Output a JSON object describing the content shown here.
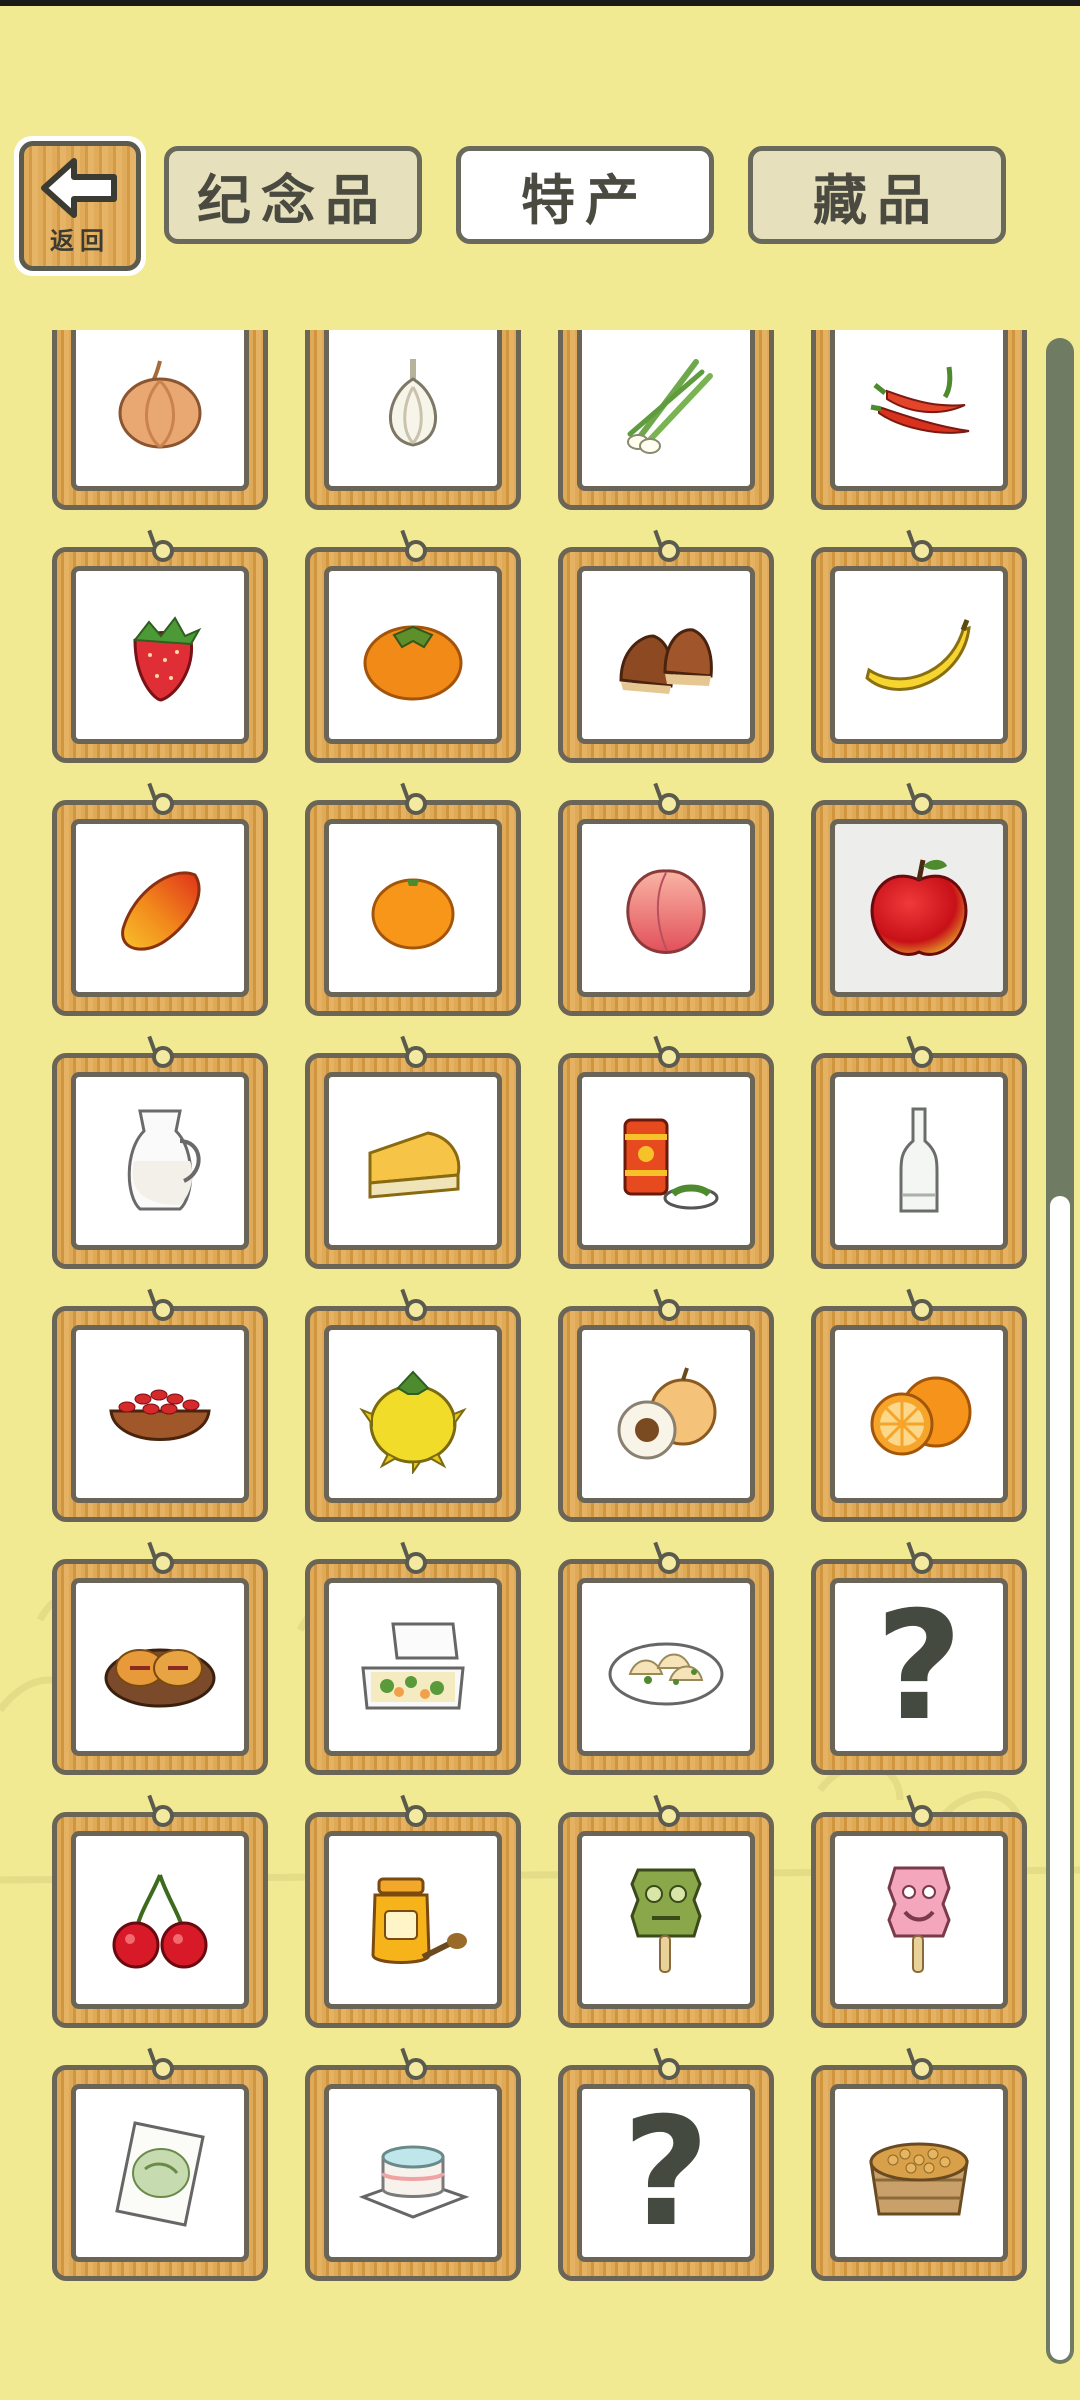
{
  "header": {
    "back_label": "返回",
    "tabs": [
      {
        "label": "纪念品",
        "active": false
      },
      {
        "label": "特产",
        "active": true
      },
      {
        "label": "藏品",
        "active": false
      }
    ]
  },
  "items": [
    {
      "icon": "onion-icon"
    },
    {
      "icon": "garlic-icon"
    },
    {
      "icon": "green-onion-icon"
    },
    {
      "icon": "chili-pepper-icon"
    },
    {
      "icon": "strawberry-icon"
    },
    {
      "icon": "persimmon-icon"
    },
    {
      "icon": "chestnut-icon"
    },
    {
      "icon": "banana-icon"
    },
    {
      "icon": "mango-icon"
    },
    {
      "icon": "mandarin-orange-icon"
    },
    {
      "icon": "peach-icon"
    },
    {
      "icon": "apple-icon",
      "selected": true
    },
    {
      "icon": "milk-jug-icon"
    },
    {
      "icon": "cheese-icon"
    },
    {
      "icon": "tea-can-icon"
    },
    {
      "icon": "glass-bottle-icon"
    },
    {
      "icon": "goji-berry-bowl-icon"
    },
    {
      "icon": "horned-melon-icon"
    },
    {
      "icon": "longan-icon"
    },
    {
      "icon": "orange-icon"
    },
    {
      "icon": "pastry-plate-icon"
    },
    {
      "icon": "bento-box-icon"
    },
    {
      "icon": "dumpling-plate-icon"
    },
    {
      "icon": "question-mark-icon",
      "text": "?"
    },
    {
      "icon": "cherry-icon"
    },
    {
      "icon": "honey-jar-icon"
    },
    {
      "icon": "mask-popsicle-icon"
    },
    {
      "icon": "pink-popsicle-icon"
    },
    {
      "icon": "tea-bag-icon"
    },
    {
      "icon": "mochi-cake-icon"
    },
    {
      "icon": "question-mark-icon",
      "text": "?"
    },
    {
      "icon": "bean-tub-icon"
    }
  ],
  "colors": {
    "background": "#f1ea92",
    "card_wood": "#dfaa57",
    "card_border": "#6b6557",
    "scroll_track": "#6f7b62",
    "scroll_thumb": "#ffffff"
  },
  "scroll": {
    "position_fraction": 0.42
  }
}
